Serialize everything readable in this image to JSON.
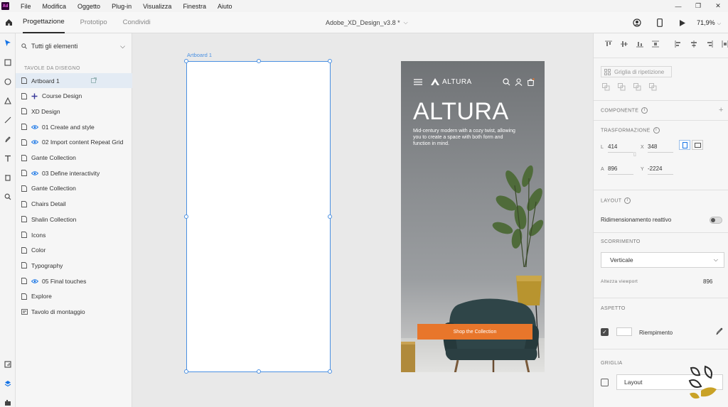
{
  "menu": [
    "File",
    "Modifica",
    "Oggetto",
    "Plug-in",
    "Visualizza",
    "Finestra",
    "Aiuto"
  ],
  "app_logo": "Xd",
  "window_controls": [
    "—",
    "❐",
    "✕"
  ],
  "tabs": [
    "Progettazione",
    "Prototipo",
    "Condividi"
  ],
  "doc_title": "Adobe_XD_Design_v3.8 *",
  "zoom": "71,9%",
  "layers": {
    "filter": "Tutti gli elementi",
    "section_label": "TAVOLE DA DISEGNO",
    "items": [
      {
        "label": "Artboard 1",
        "icon": "artboard-icon"
      },
      {
        "label": "Course Design",
        "icon": "plus-icon"
      },
      {
        "label": "XD Design",
        "icon": "artboard-icon"
      },
      {
        "label": "01 Create and style",
        "icon": "eye-icon"
      },
      {
        "label": "02 Import content Repeat Grid",
        "icon": "eye-icon"
      },
      {
        "label": "Gante Collection",
        "icon": "artboard-icon"
      },
      {
        "label": "03 Define interactivity",
        "icon": "eye-icon"
      },
      {
        "label": "Gante Collection",
        "icon": "artboard-icon"
      },
      {
        "label": "Chairs Detail",
        "icon": "artboard-icon"
      },
      {
        "label": "Shalin Collection",
        "icon": "artboard-icon"
      },
      {
        "label": "Icons",
        "icon": "artboard-icon"
      },
      {
        "label": "Color",
        "icon": "artboard-icon"
      },
      {
        "label": "Typography",
        "icon": "artboard-icon"
      },
      {
        "label": "05 Final touches",
        "icon": "eye-icon"
      },
      {
        "label": "Explore",
        "icon": "artboard-icon"
      },
      {
        "label": "Tavolo di montaggio",
        "icon": "pasteboard-icon"
      }
    ]
  },
  "canvas": {
    "artboard_label": "Artboard 1",
    "design": {
      "brand": "ALTURA",
      "title": "ALTURA",
      "subtitle": "Mid-century modern with a cozy twist, allowing you to create a space with both form and function in mind.",
      "cta": "Shop the Collection",
      "cta_color": "#e8762b"
    }
  },
  "properties": {
    "repeat_grid": "Griglia di ripetizione",
    "component_label": "COMPONENTE",
    "transform_label": "TRASFORMAZIONE",
    "w_label": "L",
    "w_value": "414",
    "x_label": "X",
    "x_value": "348",
    "h_label": "A",
    "h_value": "896",
    "y_label": "Y",
    "y_value": "-2224",
    "layout_label": "LAYOUT",
    "responsive_label": "Ridimensionamento reattivo",
    "scroll_label": "SCORRIMENTO",
    "scroll_value": "Verticale",
    "viewport_label": "Altezza viewport",
    "viewport_value": "896",
    "appearance_label": "ASPETTO",
    "fill_label": "Riempimento",
    "grid_label": "GRIGLIA",
    "grid_value": "Layout"
  },
  "colors": {
    "selection": "#4a90e2",
    "accent": "#e8762b",
    "watermark": "#c9a227"
  }
}
